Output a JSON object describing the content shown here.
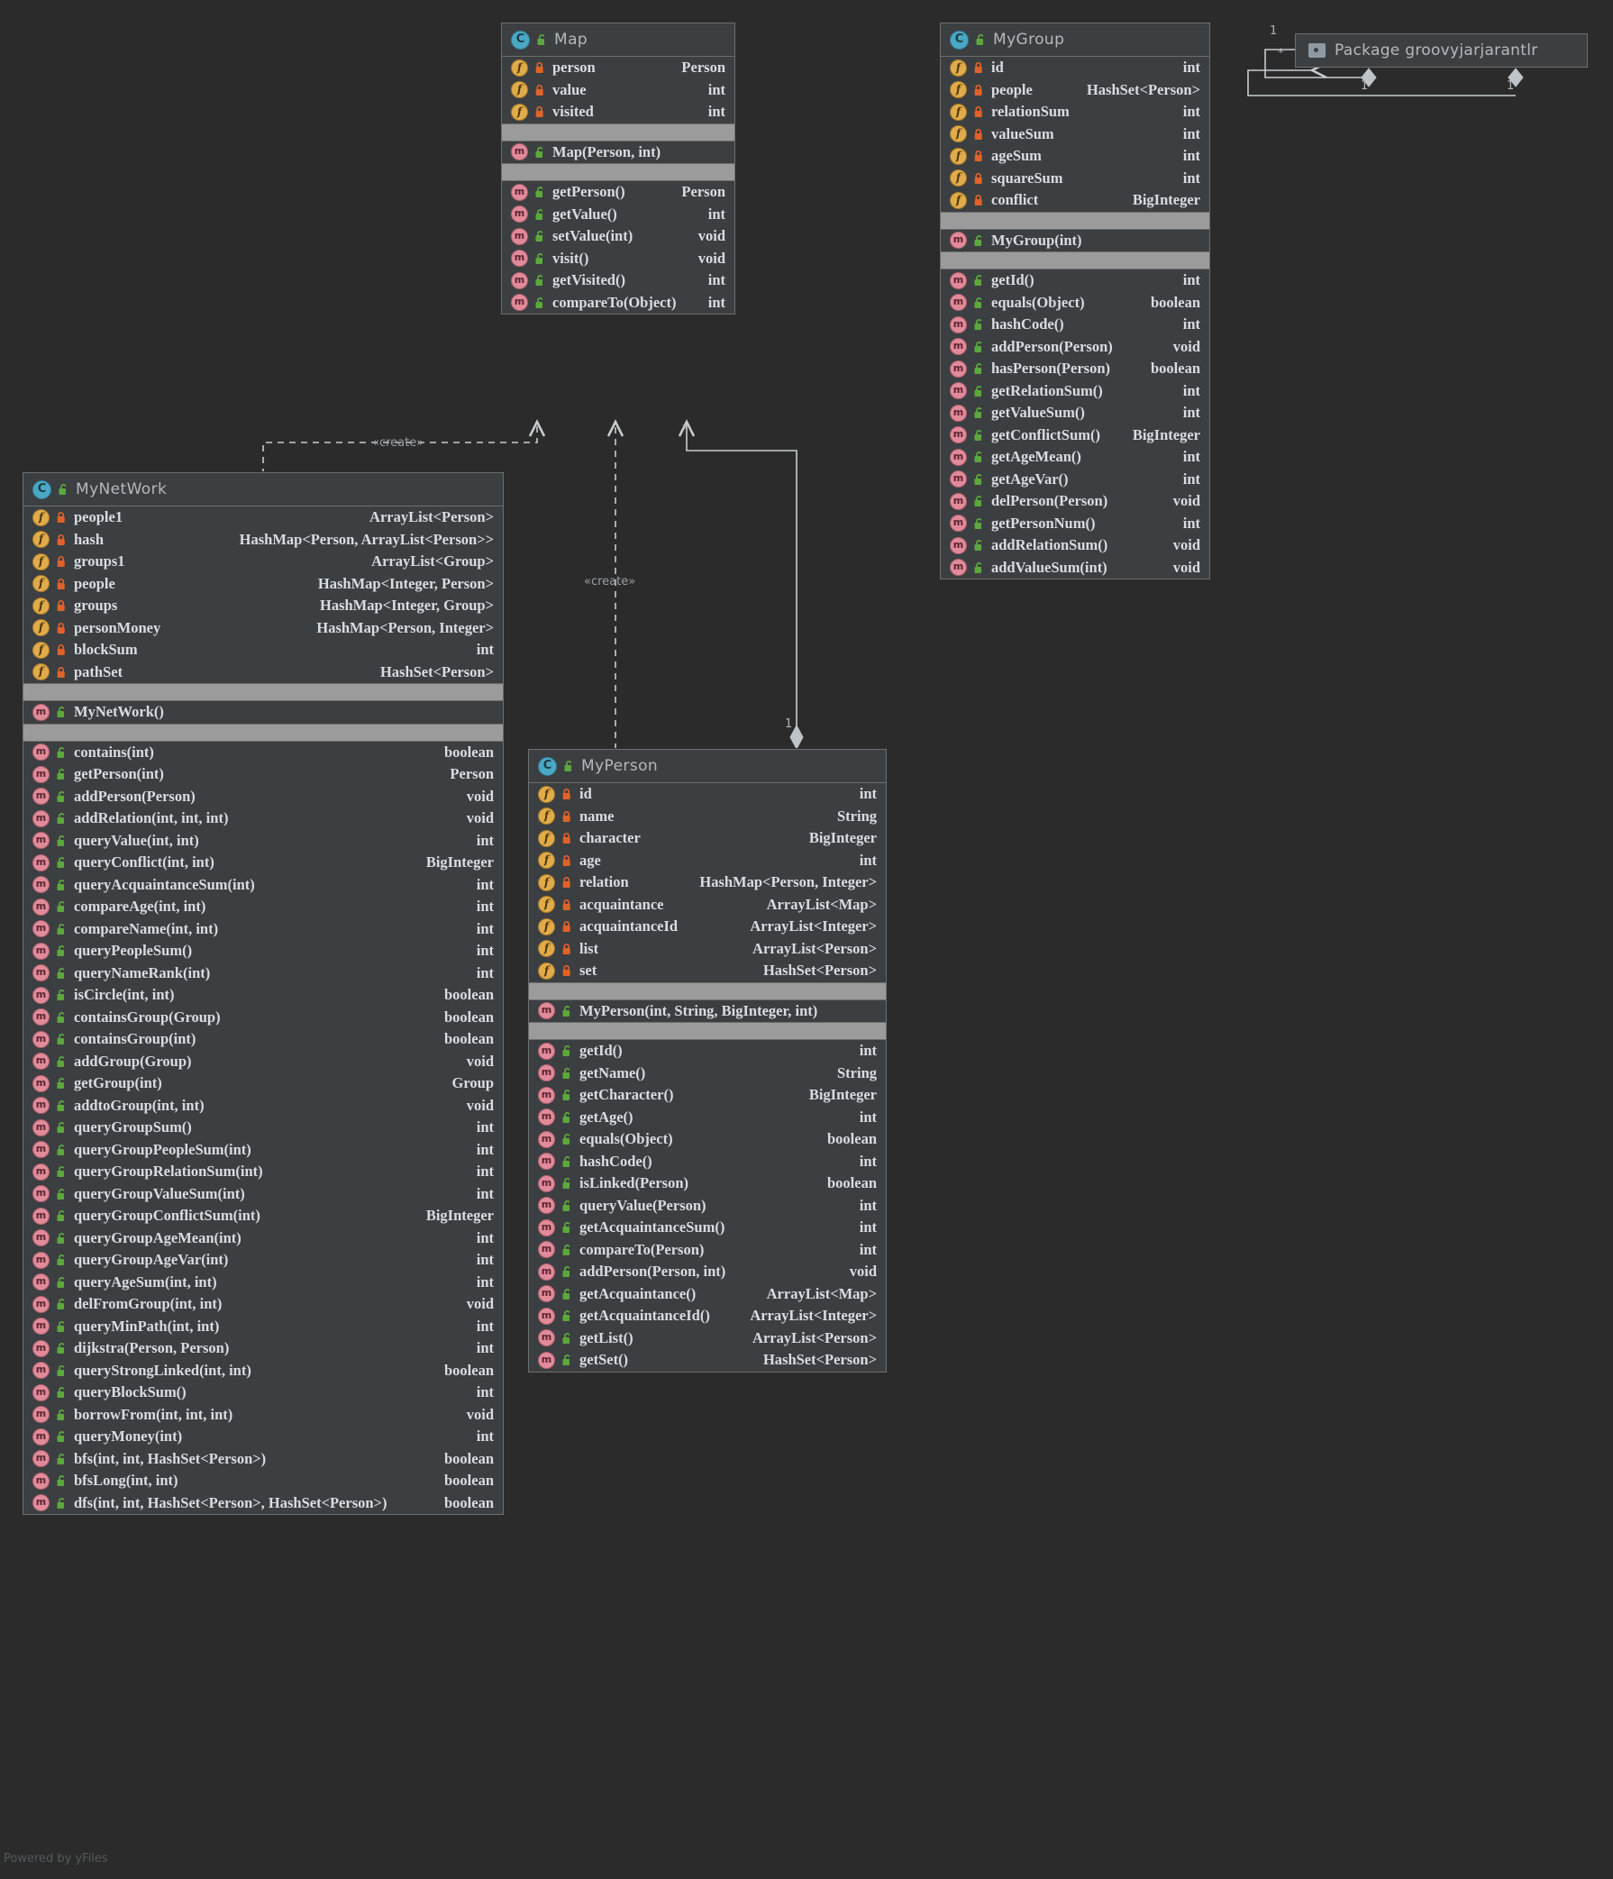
{
  "diagram": {
    "watermark": "Powered by yFiles",
    "background_color": "#2b2b2b",
    "node_fill": "#3c3f41",
    "band_fill": "#9b9b9b",
    "border_color": "#6e6e6e",
    "class_icon_color": "#4aa8c4",
    "field_icon_color": "#e0ab4a",
    "method_icon_color": "#e08a9a",
    "lock_public_color": "#5ca83c",
    "lock_private_color": "#e0622a",
    "text_color": "#d8dde2",
    "title_color": "#b4b9bd"
  },
  "classes": {
    "map": {
      "name": "Map",
      "icon": "class-icon",
      "visibility_icon": "unlocked-icon",
      "fields": [
        {
          "icon": "field-icon",
          "lock": "locked-icon",
          "name": "person",
          "type": "Person"
        },
        {
          "icon": "field-icon",
          "lock": "locked-icon",
          "name": "value",
          "type": "int"
        },
        {
          "icon": "field-icon",
          "lock": "locked-icon",
          "name": "visited",
          "type": "int"
        }
      ],
      "constructors": [
        {
          "icon": "method-icon",
          "lock": "unlocked-icon",
          "name": "Map(Person, int)",
          "type": ""
        }
      ],
      "methods": [
        {
          "icon": "method-icon",
          "lock": "unlocked-icon",
          "name": "getPerson()",
          "type": "Person"
        },
        {
          "icon": "method-icon",
          "lock": "unlocked-icon",
          "name": "getValue()",
          "type": "int"
        },
        {
          "icon": "method-icon",
          "lock": "unlocked-icon",
          "name": "setValue(int)",
          "type": "void"
        },
        {
          "icon": "method-icon",
          "lock": "unlocked-icon",
          "name": "visit()",
          "type": "void"
        },
        {
          "icon": "method-icon",
          "lock": "unlocked-icon",
          "name": "getVisited()",
          "type": "int"
        },
        {
          "icon": "method-icon",
          "lock": "unlocked-icon",
          "name": "compareTo(Object)",
          "type": "int"
        }
      ]
    },
    "mygroup": {
      "name": "MyGroup",
      "icon": "class-icon",
      "visibility_icon": "unlocked-icon",
      "fields": [
        {
          "icon": "field-icon",
          "lock": "locked-icon",
          "name": "id",
          "type": "int"
        },
        {
          "icon": "field-icon",
          "lock": "locked-icon",
          "name": "people",
          "type": "HashSet<Person>"
        },
        {
          "icon": "field-icon",
          "lock": "locked-icon",
          "name": "relationSum",
          "type": "int"
        },
        {
          "icon": "field-icon",
          "lock": "locked-icon",
          "name": "valueSum",
          "type": "int"
        },
        {
          "icon": "field-icon",
          "lock": "locked-icon",
          "name": "ageSum",
          "type": "int"
        },
        {
          "icon": "field-icon",
          "lock": "locked-icon",
          "name": "squareSum",
          "type": "int"
        },
        {
          "icon": "field-icon",
          "lock": "locked-icon",
          "name": "conflict",
          "type": "BigInteger"
        }
      ],
      "constructors": [
        {
          "icon": "method-icon",
          "lock": "unlocked-icon",
          "name": "MyGroup(int)",
          "type": ""
        }
      ],
      "methods": [
        {
          "icon": "method-icon",
          "lock": "unlocked-icon",
          "name": "getId()",
          "type": "int"
        },
        {
          "icon": "method-icon",
          "lock": "unlocked-icon",
          "name": "equals(Object)",
          "type": "boolean"
        },
        {
          "icon": "method-icon",
          "lock": "unlocked-icon",
          "name": "hashCode()",
          "type": "int"
        },
        {
          "icon": "method-icon",
          "lock": "unlocked-icon",
          "name": "addPerson(Person)",
          "type": "void"
        },
        {
          "icon": "method-icon",
          "lock": "unlocked-icon",
          "name": "hasPerson(Person)",
          "type": "boolean"
        },
        {
          "icon": "method-icon",
          "lock": "unlocked-icon",
          "name": "getRelationSum()",
          "type": "int"
        },
        {
          "icon": "method-icon",
          "lock": "unlocked-icon",
          "name": "getValueSum()",
          "type": "int"
        },
        {
          "icon": "method-icon",
          "lock": "unlocked-icon",
          "name": "getConflictSum()",
          "type": "BigInteger"
        },
        {
          "icon": "method-icon",
          "lock": "unlocked-icon",
          "name": "getAgeMean()",
          "type": "int"
        },
        {
          "icon": "method-icon",
          "lock": "unlocked-icon",
          "name": "getAgeVar()",
          "type": "int"
        },
        {
          "icon": "method-icon",
          "lock": "unlocked-icon",
          "name": "delPerson(Person)",
          "type": "void"
        },
        {
          "icon": "method-icon",
          "lock": "unlocked-icon",
          "name": "getPersonNum()",
          "type": "int"
        },
        {
          "icon": "method-icon",
          "lock": "unlocked-icon",
          "name": "addRelationSum()",
          "type": "void"
        },
        {
          "icon": "method-icon",
          "lock": "unlocked-icon",
          "name": "addValueSum(int)",
          "type": "void"
        }
      ]
    },
    "mynetwork": {
      "name": "MyNetWork",
      "icon": "class-icon",
      "visibility_icon": "unlocked-icon",
      "fields": [
        {
          "icon": "field-icon",
          "lock": "locked-icon",
          "name": "people1",
          "type": "ArrayList<Person>"
        },
        {
          "icon": "field-icon",
          "lock": "locked-icon",
          "name": "hash",
          "type": "HashMap<Person, ArrayList<Person>>"
        },
        {
          "icon": "field-icon",
          "lock": "locked-icon",
          "name": "groups1",
          "type": "ArrayList<Group>"
        },
        {
          "icon": "field-icon",
          "lock": "locked-icon",
          "name": "people",
          "type": "HashMap<Integer, Person>"
        },
        {
          "icon": "field-icon",
          "lock": "locked-icon",
          "name": "groups",
          "type": "HashMap<Integer, Group>"
        },
        {
          "icon": "field-icon",
          "lock": "locked-icon",
          "name": "personMoney",
          "type": "HashMap<Person, Integer>"
        },
        {
          "icon": "field-icon",
          "lock": "locked-icon",
          "name": "blockSum",
          "type": "int"
        },
        {
          "icon": "field-icon",
          "lock": "locked-icon",
          "name": "pathSet",
          "type": "HashSet<Person>"
        }
      ],
      "constructors": [
        {
          "icon": "method-icon",
          "lock": "unlocked-icon",
          "name": "MyNetWork()",
          "type": ""
        }
      ],
      "methods": [
        {
          "icon": "method-icon",
          "lock": "unlocked-icon",
          "name": "contains(int)",
          "type": "boolean"
        },
        {
          "icon": "method-icon",
          "lock": "unlocked-icon",
          "name": "getPerson(int)",
          "type": "Person"
        },
        {
          "icon": "method-icon",
          "lock": "unlocked-icon",
          "name": "addPerson(Person)",
          "type": "void"
        },
        {
          "icon": "method-icon",
          "lock": "unlocked-icon",
          "name": "addRelation(int, int, int)",
          "type": "void"
        },
        {
          "icon": "method-icon",
          "lock": "unlocked-icon",
          "name": "queryValue(int, int)",
          "type": "int"
        },
        {
          "icon": "method-icon",
          "lock": "unlocked-icon",
          "name": "queryConflict(int, int)",
          "type": "BigInteger"
        },
        {
          "icon": "method-icon",
          "lock": "unlocked-icon",
          "name": "queryAcquaintanceSum(int)",
          "type": "int"
        },
        {
          "icon": "method-icon",
          "lock": "unlocked-icon",
          "name": "compareAge(int, int)",
          "type": "int"
        },
        {
          "icon": "method-icon",
          "lock": "unlocked-icon",
          "name": "compareName(int, int)",
          "type": "int"
        },
        {
          "icon": "method-icon",
          "lock": "unlocked-icon",
          "name": "queryPeopleSum()",
          "type": "int"
        },
        {
          "icon": "method-icon",
          "lock": "unlocked-icon",
          "name": "queryNameRank(int)",
          "type": "int"
        },
        {
          "icon": "method-icon",
          "lock": "unlocked-icon",
          "name": "isCircle(int, int)",
          "type": "boolean"
        },
        {
          "icon": "method-icon",
          "lock": "unlocked-icon",
          "name": "containsGroup(Group)",
          "type": "boolean"
        },
        {
          "icon": "method-icon",
          "lock": "unlocked-icon",
          "name": "containsGroup(int)",
          "type": "boolean"
        },
        {
          "icon": "method-icon",
          "lock": "unlocked-icon",
          "name": "addGroup(Group)",
          "type": "void"
        },
        {
          "icon": "method-icon",
          "lock": "unlocked-icon",
          "name": "getGroup(int)",
          "type": "Group"
        },
        {
          "icon": "method-icon",
          "lock": "unlocked-icon",
          "name": "addtoGroup(int, int)",
          "type": "void"
        },
        {
          "icon": "method-icon",
          "lock": "unlocked-icon",
          "name": "queryGroupSum()",
          "type": "int"
        },
        {
          "icon": "method-icon",
          "lock": "unlocked-icon",
          "name": "queryGroupPeopleSum(int)",
          "type": "int"
        },
        {
          "icon": "method-icon",
          "lock": "unlocked-icon",
          "name": "queryGroupRelationSum(int)",
          "type": "int"
        },
        {
          "icon": "method-icon",
          "lock": "unlocked-icon",
          "name": "queryGroupValueSum(int)",
          "type": "int"
        },
        {
          "icon": "method-icon",
          "lock": "unlocked-icon",
          "name": "queryGroupConflictSum(int)",
          "type": "BigInteger"
        },
        {
          "icon": "method-icon",
          "lock": "unlocked-icon",
          "name": "queryGroupAgeMean(int)",
          "type": "int"
        },
        {
          "icon": "method-icon",
          "lock": "unlocked-icon",
          "name": "queryGroupAgeVar(int)",
          "type": "int"
        },
        {
          "icon": "method-icon",
          "lock": "unlocked-icon",
          "name": "queryAgeSum(int, int)",
          "type": "int"
        },
        {
          "icon": "method-icon",
          "lock": "unlocked-icon",
          "name": "delFromGroup(int, int)",
          "type": "void"
        },
        {
          "icon": "method-icon",
          "lock": "unlocked-icon",
          "name": "queryMinPath(int, int)",
          "type": "int"
        },
        {
          "icon": "method-icon",
          "lock": "unlocked-icon",
          "name": "dijkstra(Person, Person)",
          "type": "int"
        },
        {
          "icon": "method-icon",
          "lock": "unlocked-icon",
          "name": "queryStrongLinked(int, int)",
          "type": "boolean"
        },
        {
          "icon": "method-icon",
          "lock": "unlocked-icon",
          "name": "queryBlockSum()",
          "type": "int"
        },
        {
          "icon": "method-icon",
          "lock": "unlocked-icon",
          "name": "borrowFrom(int, int, int)",
          "type": "void"
        },
        {
          "icon": "method-icon",
          "lock": "unlocked-icon",
          "name": "queryMoney(int)",
          "type": "int"
        },
        {
          "icon": "method-icon",
          "lock": "unlocked-icon",
          "name": "bfs(int, int, HashSet<Person>)",
          "type": "boolean"
        },
        {
          "icon": "method-icon",
          "lock": "unlocked-icon",
          "name": "bfsLong(int, int)",
          "type": "boolean"
        },
        {
          "icon": "method-icon",
          "lock": "unlocked-icon",
          "name": "dfs(int, int, HashSet<Person>, HashSet<Person>)",
          "type": "boolean"
        }
      ]
    },
    "myperson": {
      "name": "MyPerson",
      "icon": "class-icon",
      "visibility_icon": "unlocked-icon",
      "fields": [
        {
          "icon": "field-icon",
          "lock": "locked-icon",
          "name": "id",
          "type": "int"
        },
        {
          "icon": "field-icon",
          "lock": "locked-icon",
          "name": "name",
          "type": "String"
        },
        {
          "icon": "field-icon",
          "lock": "locked-icon",
          "name": "character",
          "type": "BigInteger"
        },
        {
          "icon": "field-icon",
          "lock": "locked-icon",
          "name": "age",
          "type": "int"
        },
        {
          "icon": "field-icon",
          "lock": "locked-icon",
          "name": "relation",
          "type": "HashMap<Person, Integer>"
        },
        {
          "icon": "field-icon",
          "lock": "locked-icon",
          "name": "acquaintance",
          "type": "ArrayList<Map>"
        },
        {
          "icon": "field-icon",
          "lock": "locked-icon",
          "name": "acquaintanceId",
          "type": "ArrayList<Integer>"
        },
        {
          "icon": "field-icon",
          "lock": "locked-icon",
          "name": "list",
          "type": "ArrayList<Person>"
        },
        {
          "icon": "field-icon",
          "lock": "locked-icon",
          "name": "set",
          "type": "HashSet<Person>"
        }
      ],
      "constructors": [
        {
          "icon": "method-icon",
          "lock": "unlocked-icon",
          "name": "MyPerson(int, String, BigInteger, int)",
          "type": ""
        }
      ],
      "methods": [
        {
          "icon": "method-icon",
          "lock": "unlocked-icon",
          "name": "getId()",
          "type": "int"
        },
        {
          "icon": "method-icon",
          "lock": "unlocked-icon",
          "name": "getName()",
          "type": "String"
        },
        {
          "icon": "method-icon",
          "lock": "unlocked-icon",
          "name": "getCharacter()",
          "type": "BigInteger"
        },
        {
          "icon": "method-icon",
          "lock": "unlocked-icon",
          "name": "getAge()",
          "type": "int"
        },
        {
          "icon": "method-icon",
          "lock": "unlocked-icon",
          "name": "equals(Object)",
          "type": "boolean"
        },
        {
          "icon": "method-icon",
          "lock": "unlocked-icon",
          "name": "hashCode()",
          "type": "int"
        },
        {
          "icon": "method-icon",
          "lock": "unlocked-icon",
          "name": "isLinked(Person)",
          "type": "boolean"
        },
        {
          "icon": "method-icon",
          "lock": "unlocked-icon",
          "name": "queryValue(Person)",
          "type": "int"
        },
        {
          "icon": "method-icon",
          "lock": "unlocked-icon",
          "name": "getAcquaintanceSum()",
          "type": "int"
        },
        {
          "icon": "method-icon",
          "lock": "unlocked-icon",
          "name": "compareTo(Person)",
          "type": "int"
        },
        {
          "icon": "method-icon",
          "lock": "unlocked-icon",
          "name": "addPerson(Person, int)",
          "type": "void"
        },
        {
          "icon": "method-icon",
          "lock": "unlocked-icon",
          "name": "getAcquaintance()",
          "type": "ArrayList<Map>"
        },
        {
          "icon": "method-icon",
          "lock": "unlocked-icon",
          "name": "getAcquaintanceId()",
          "type": "ArrayList<Integer>"
        },
        {
          "icon": "method-icon",
          "lock": "unlocked-icon",
          "name": "getList()",
          "type": "ArrayList<Person>"
        },
        {
          "icon": "method-icon",
          "lock": "unlocked-icon",
          "name": "getSet()",
          "type": "HashSet<Person>"
        }
      ]
    }
  },
  "package_node": {
    "icon": "folder-icon",
    "label": "Package groovyjarjarantlr"
  },
  "edges": {
    "create_mynetwork_map": "«create»",
    "create_myperson_map": "«create»",
    "mult_star_map": "*",
    "mult_one_myperson": "1",
    "pkg_mult_1": "1",
    "pkg_mult_star": "*",
    "pkg_mult_diamond_left": "1",
    "pkg_mult_diamond_right": "1"
  }
}
